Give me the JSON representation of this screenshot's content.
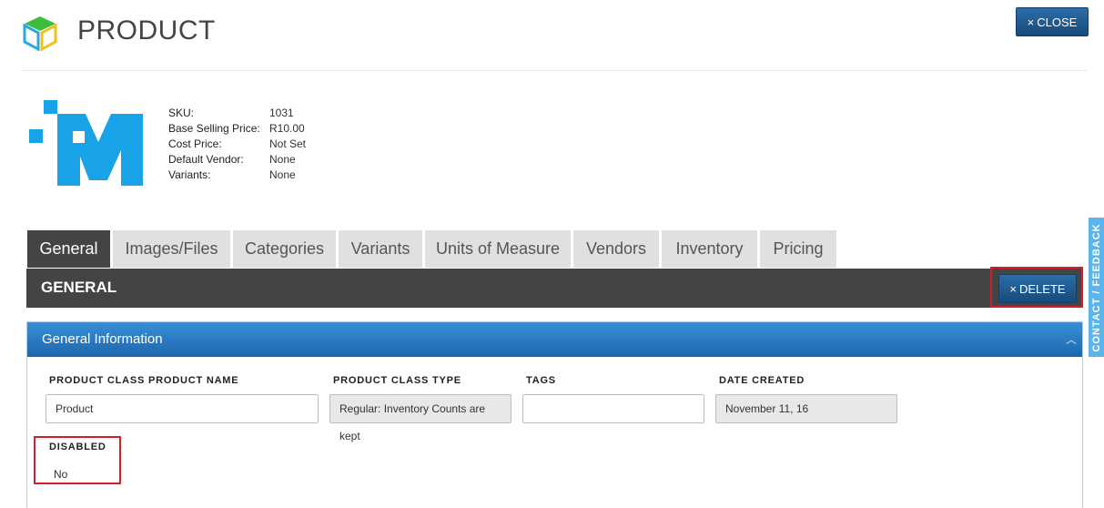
{
  "header": {
    "title": "PRODUCT",
    "close_label": "CLOSE",
    "icon": "cube-icon"
  },
  "summary": [
    {
      "label": "SKU:",
      "value": "1031"
    },
    {
      "label": "Base Selling Price:",
      "value": "R10.00"
    },
    {
      "label": "Cost Price:",
      "value": "Not Set"
    },
    {
      "label": "Default Vendor:",
      "value": "None"
    },
    {
      "label": "Variants:",
      "value": "None"
    }
  ],
  "tabs": [
    {
      "label": "General",
      "active": true
    },
    {
      "label": "Images/Files"
    },
    {
      "label": "Categories"
    },
    {
      "label": "Variants"
    },
    {
      "label": "Units of Measure"
    },
    {
      "label": "Vendors"
    },
    {
      "label": "Inventory"
    },
    {
      "label": "Pricing"
    }
  ],
  "section": {
    "title": "GENERAL",
    "delete_label": "DELETE"
  },
  "panel": {
    "title": "General Information",
    "fields": {
      "name": {
        "label": "PRODUCT CLASS PRODUCT NAME",
        "value": "Product"
      },
      "type": {
        "label": "PRODUCT CLASS TYPE",
        "value": "Regular: Inventory Counts are kept"
      },
      "tags": {
        "label": "TAGS",
        "value": ""
      },
      "date": {
        "label": "DATE CREATED",
        "value": "November 11, 16"
      },
      "disabled": {
        "label": "DISABLED",
        "value": "No"
      }
    }
  },
  "feedback": {
    "label": "CONTACT / FEEDBACK"
  },
  "colors": {
    "accent": "#2b6ea8",
    "dark_bar": "#444444",
    "panel_blue": "#2a7cc4",
    "highlight": "#d0202a",
    "feedback": "#5db4ea"
  }
}
